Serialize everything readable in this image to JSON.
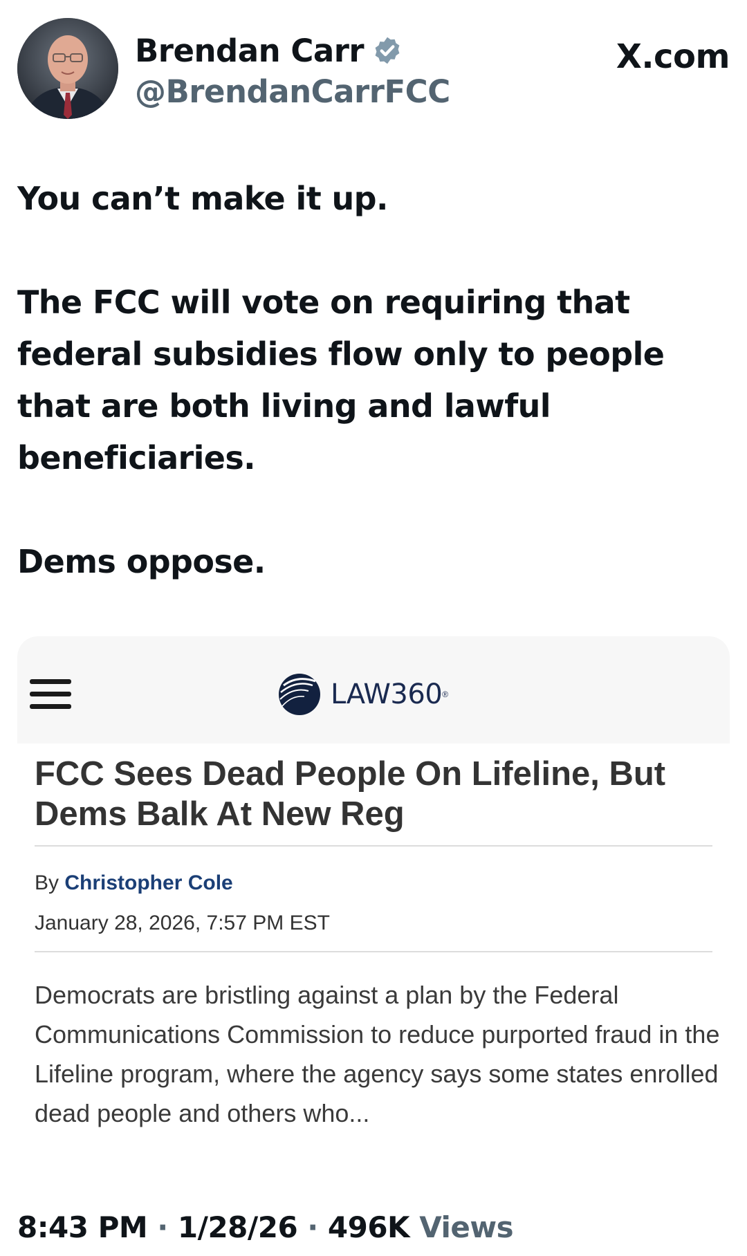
{
  "author": {
    "name": "Brendan Carr",
    "handle": "@BrendanCarrFCC",
    "verified": true,
    "verified_color": "#829aab"
  },
  "site_label": "X.com",
  "tweet": {
    "paragraphs": [
      "You can’t make it up.",
      "The FCC will vote on requiring that federal subsidies flow only to people that are both living and lawful beneficiaries.",
      "Dems oppose."
    ]
  },
  "card": {
    "menu_icon": "hamburger-menu-icon",
    "logo_text": "LAW360",
    "logo_reg": "®",
    "title": "FCC Sees Dead People On Lifeline, But Dems Balk At New Reg",
    "byline_prefix": "By",
    "byline_author": "Christopher Cole",
    "date": "January 28, 2026, 7:57 PM EST",
    "summary": "Democrats are bristling against a plan by the Federal Communications Commission to reduce purported fraud in the Lifeline program, where the agency says some states enrolled dead people and others who...",
    "author_link_color": "#1b3f76"
  },
  "meta": {
    "time": "8:43 PM",
    "separator": " · ",
    "date": "1/28/26",
    "views_count": "496K",
    "views_label": "Views"
  }
}
